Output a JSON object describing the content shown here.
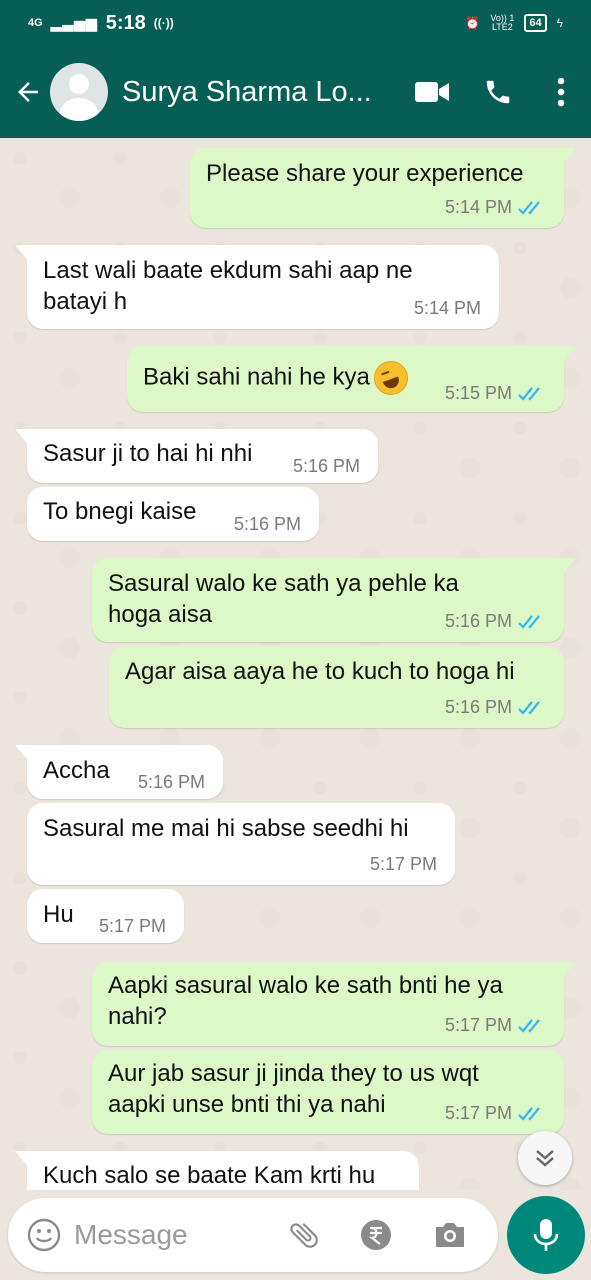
{
  "status_bar": {
    "network": "4G",
    "time": "5:18",
    "volte": "Vo)) 1",
    "lte": "LTE2",
    "battery": "64"
  },
  "header": {
    "contact_name": "Surya Sharma Lo..."
  },
  "messages": [
    {
      "direction": "out",
      "text": "Please share your experience",
      "time": "5:14 PM",
      "read": true
    },
    {
      "direction": "in",
      "lines": [
        "Last wali baate ekdum sahi aap ne",
        "batayi h"
      ],
      "time": "5:14 PM"
    },
    {
      "direction": "out",
      "text": "Baki sahi nahi he kya",
      "emoji": "rolling-on-floor-laughing",
      "time": "5:15 PM",
      "read": true
    },
    {
      "direction": "in",
      "text": "Sasur ji to hai hi nhi",
      "time": "5:16 PM"
    },
    {
      "direction": "in",
      "text": "To bnegi kaise",
      "time": "5:16 PM"
    },
    {
      "direction": "out",
      "lines": [
        "Sasural walo ke sath ya pehle ka",
        "hoga aisa"
      ],
      "time": "5:16 PM",
      "read": true
    },
    {
      "direction": "out",
      "text": "Agar aisa aaya he to kuch to hoga hi",
      "time": "5:16 PM",
      "read": true
    },
    {
      "direction": "in",
      "text": "Accha",
      "time": "5:16 PM"
    },
    {
      "direction": "in",
      "text": "Sasural me mai hi sabse seedhi hi",
      "time": "5:17 PM"
    },
    {
      "direction": "in",
      "text": "Hu",
      "time": "5:17 PM"
    },
    {
      "direction": "out",
      "lines": [
        "Aapki sasural walo ke sath bnti he ya",
        "nahi?"
      ],
      "time": "5:17 PM",
      "read": true
    },
    {
      "direction": "out",
      "lines": [
        "Aur jab sasur ji jinda they to us wqt",
        "aapki unse bnti thi ya nahi"
      ],
      "time": "5:17 PM",
      "read": true
    },
    {
      "direction": "in",
      "text": "Kuch salo se baate Kam krti hu",
      "time": ""
    }
  ],
  "composer": {
    "placeholder": "Message"
  },
  "icons": {
    "back": "back-arrow-icon",
    "video": "video-call-icon",
    "voice": "voice-call-icon",
    "menu": "more-vert-icon",
    "emoji": "emoji-icon",
    "attach": "attach-icon",
    "payment": "rupee-icon",
    "camera": "camera-icon",
    "mic": "mic-icon",
    "scroll": "scroll-down-icon"
  },
  "colors": {
    "header": "#075e54",
    "outgoing": "#dcf8c6",
    "incoming": "#ffffff",
    "read_ticks": "#34b7f1",
    "mic": "#00897b"
  }
}
